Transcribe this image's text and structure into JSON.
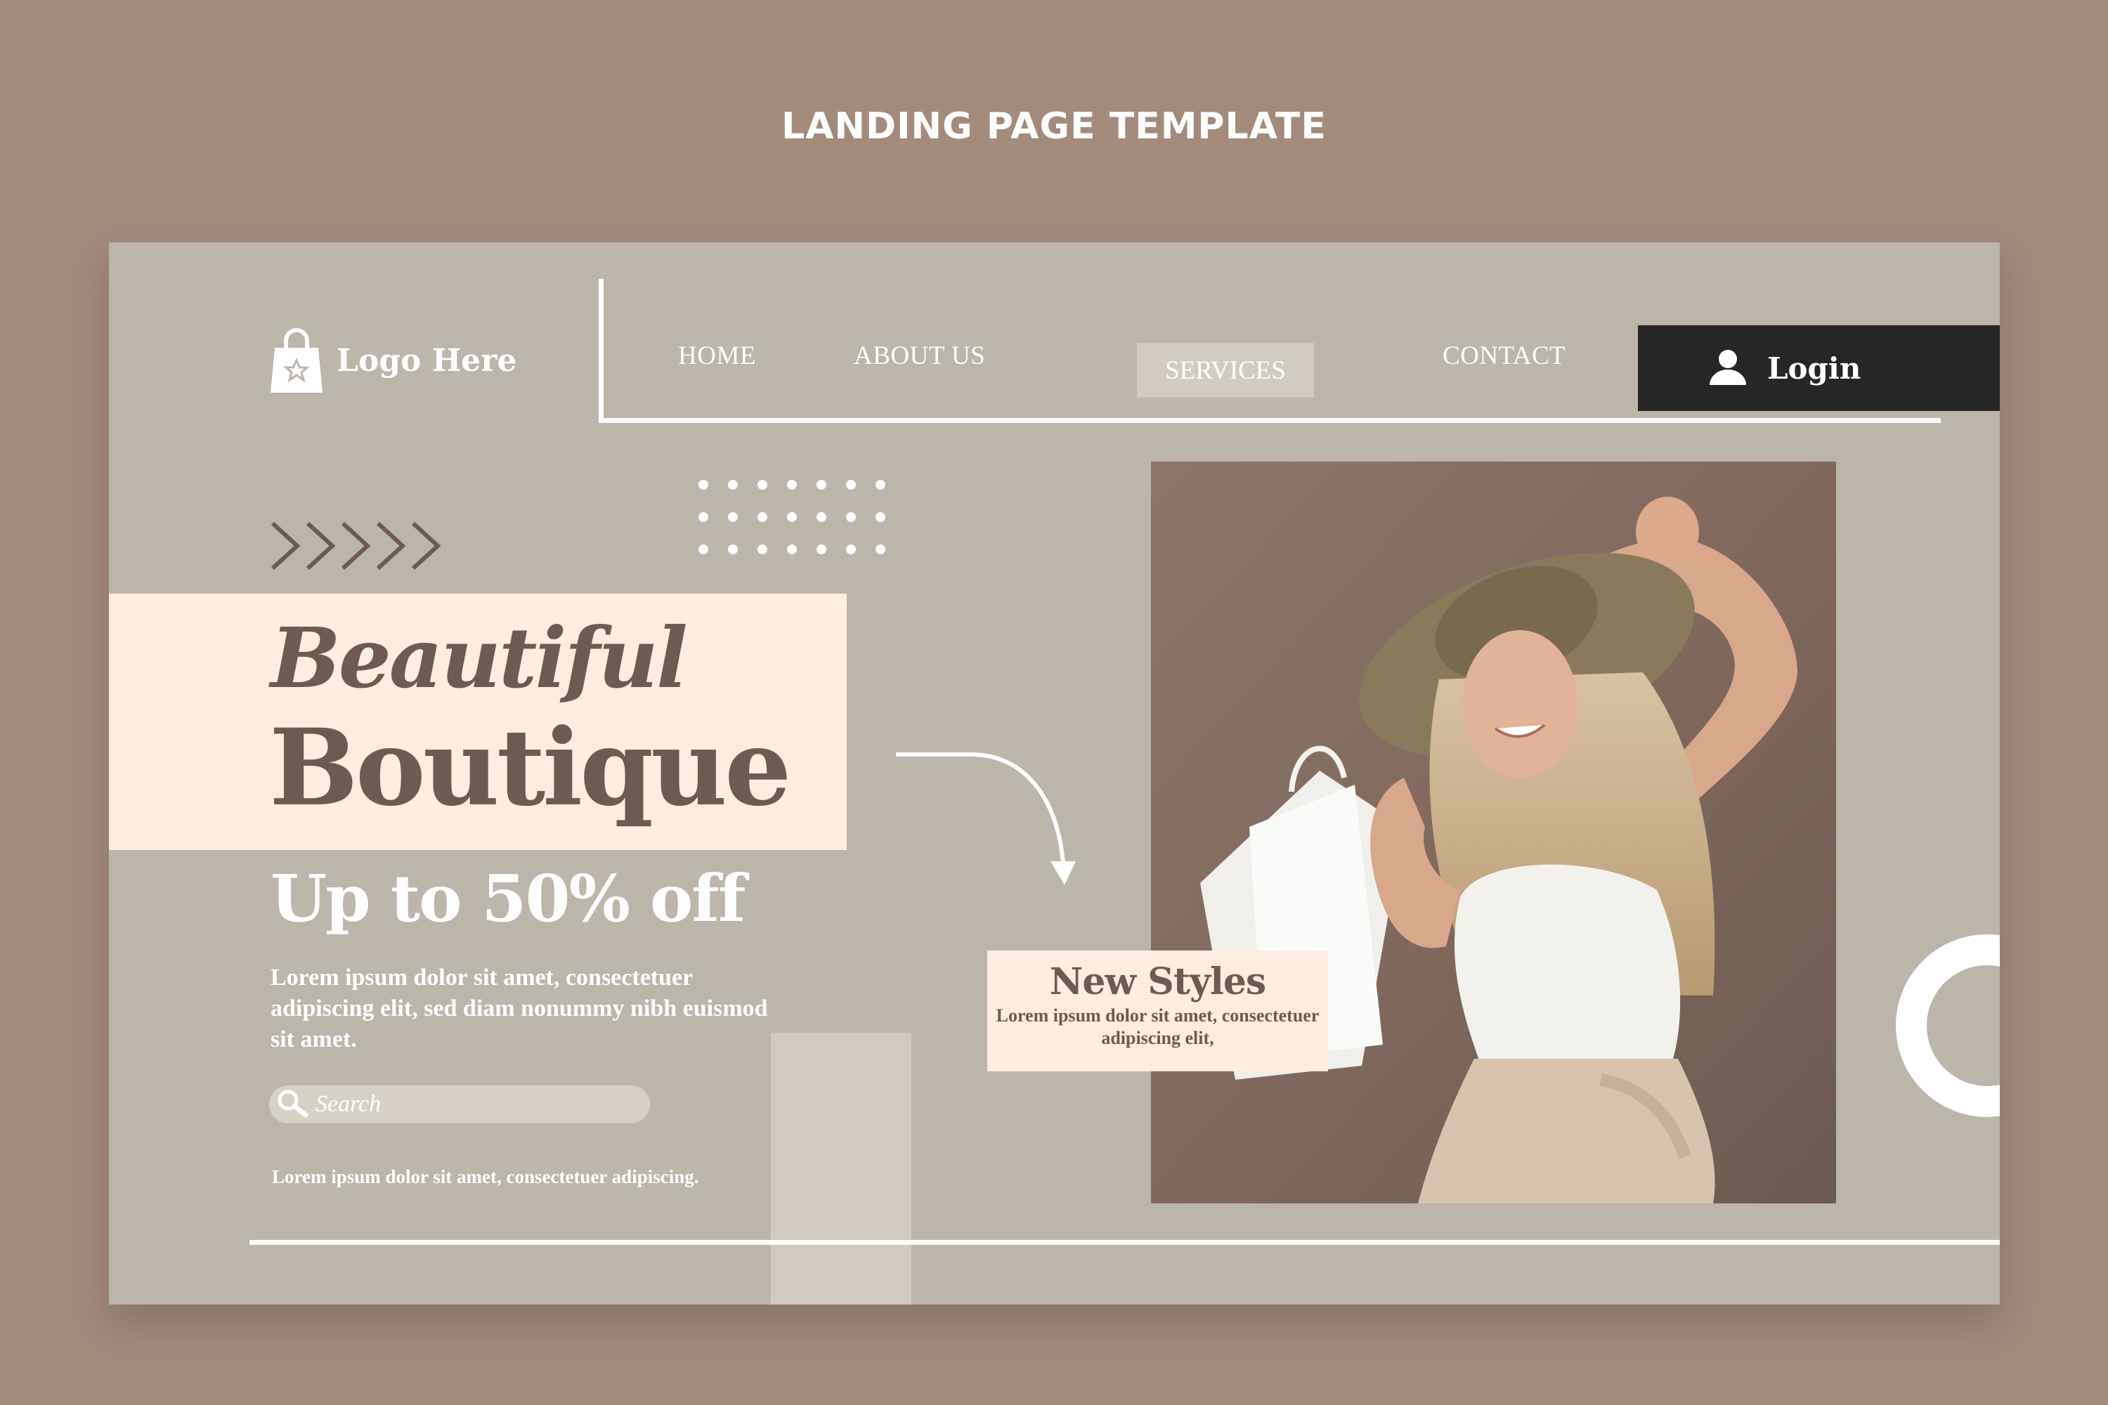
{
  "page": {
    "heading": "LANDING PAGE TEMPLATE"
  },
  "header": {
    "logo_text": "Logo Here",
    "nav": {
      "home": "HOME",
      "about": "ABOUT US",
      "services": "SERVICES",
      "contact": "CONTACT"
    },
    "login_label": "Login"
  },
  "hero": {
    "title_line1": "Beautiful",
    "title_line2": "Boutique",
    "offer": "Up to 50% off",
    "description": "Lorem ipsum dolor sit amet, consectetuer adipiscing elit, sed diam nonummy nibh euismod sit amet.",
    "search_placeholder": "Search",
    "note": "Lorem ipsum dolor sit amet, consectetuer adipiscing."
  },
  "promo": {
    "title": "New Styles",
    "text": "Lorem ipsum dolor sit amet, consectetuer adipiscing elit,"
  },
  "colors": {
    "background": "#a38a7b",
    "panel": "#bbb5aa",
    "cream": "#ffeddf",
    "brown_text": "#6e5a50",
    "login_bg": "#262626"
  },
  "icons": [
    "shopping-bag-icon",
    "user-icon",
    "search-icon",
    "chevrons-icon",
    "arrow-icon"
  ]
}
